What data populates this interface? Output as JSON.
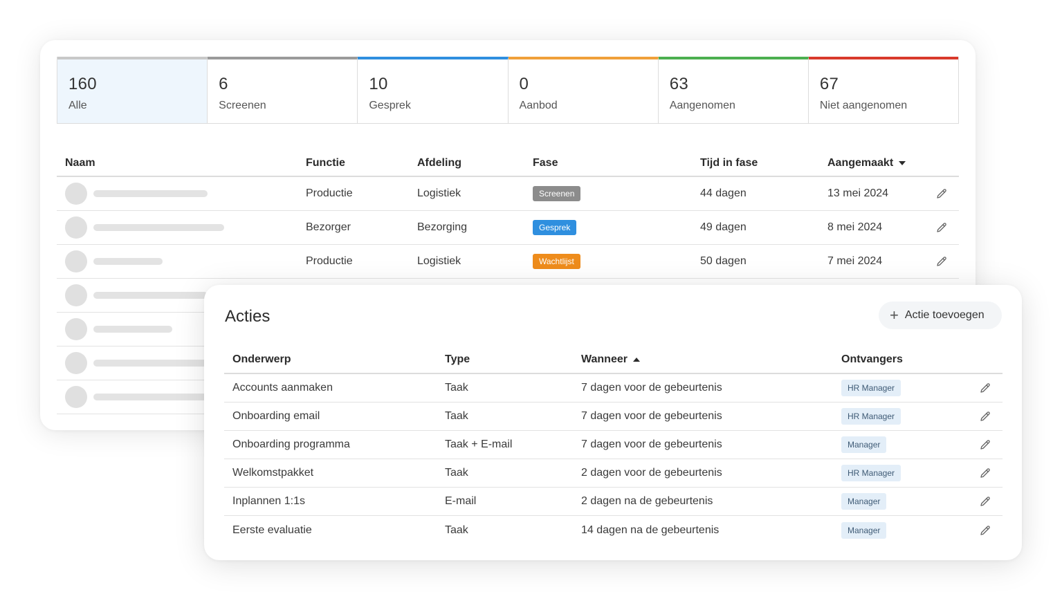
{
  "stats": [
    {
      "count": "160",
      "label": "Alle",
      "color": "#c8c8c8",
      "active": true
    },
    {
      "count": "6",
      "label": "Screenen",
      "color": "#9a9a9a",
      "active": false
    },
    {
      "count": "10",
      "label": "Gesprek",
      "color": "#2f8fdf",
      "active": false
    },
    {
      "count": "0",
      "label": "Aanbod",
      "color": "#f0a03a",
      "active": false
    },
    {
      "count": "63",
      "label": "Aangenomen",
      "color": "#4caf50",
      "active": false
    },
    {
      "count": "67",
      "label": "Niet aangenomen",
      "color": "#d93a2b",
      "active": false
    }
  ],
  "candidates": {
    "headers": {
      "naam": "Naam",
      "functie": "Functie",
      "afdeling": "Afdeling",
      "fase": "Fase",
      "tijd": "Tijd in fase",
      "aangemaakt": "Aangemaakt"
    },
    "rows": [
      {
        "functie": "Productie",
        "afdeling": "Logistiek",
        "fase": "Screenen",
        "fase_color": "#8c8c8c",
        "tijd": "44 dagen",
        "aangemaakt": "13 mei 2024",
        "name_bar": 165
      },
      {
        "functie": "Bezorger",
        "afdeling": "Bezorging",
        "fase": "Gesprek",
        "fase_color": "#2f8fdf",
        "tijd": "49 dagen",
        "aangemaakt": "8 mei 2024",
        "name_bar": 189
      },
      {
        "functie": "Productie",
        "afdeling": "Logistiek",
        "fase": "Wachtlijst",
        "fase_color": "#ee8c1c",
        "tijd": "50 dagen",
        "aangemaakt": "7 mei 2024",
        "name_bar": 100
      },
      {
        "name_bar": 165
      },
      {
        "name_bar": 114
      },
      {
        "name_bar": 165
      },
      {
        "name_bar": 165
      }
    ]
  },
  "acties": {
    "title": "Acties",
    "add_label": "Actie toevoegen",
    "headers": {
      "onderwerp": "Onderwerp",
      "type": "Type",
      "wanneer": "Wanneer",
      "ontvangers": "Ontvangers"
    },
    "rows": [
      {
        "onderwerp": "Accounts aanmaken",
        "type": "Taak",
        "wanneer": "7 dagen voor de gebeurtenis",
        "ontvanger": "HR Manager"
      },
      {
        "onderwerp": "Onboarding email",
        "type": "Taak",
        "wanneer": "7 dagen voor de gebeurtenis",
        "ontvanger": "HR Manager"
      },
      {
        "onderwerp": "Onboarding programma",
        "type": "Taak + E-mail",
        "wanneer": "7 dagen voor de gebeurtenis",
        "ontvanger": "Manager"
      },
      {
        "onderwerp": "Welkomstpakket",
        "type": "Taak",
        "wanneer": "2 dagen voor de gebeurtenis",
        "ontvanger": "HR Manager"
      },
      {
        "onderwerp": "Inplannen 1:1s",
        "type": "E-mail",
        "wanneer": "2 dagen na de gebeurtenis",
        "ontvanger": "Manager"
      },
      {
        "onderwerp": "Eerste evaluatie",
        "type": "Taak",
        "wanneer": "14 dagen na de gebeurtenis",
        "ontvanger": "Manager"
      }
    ]
  }
}
